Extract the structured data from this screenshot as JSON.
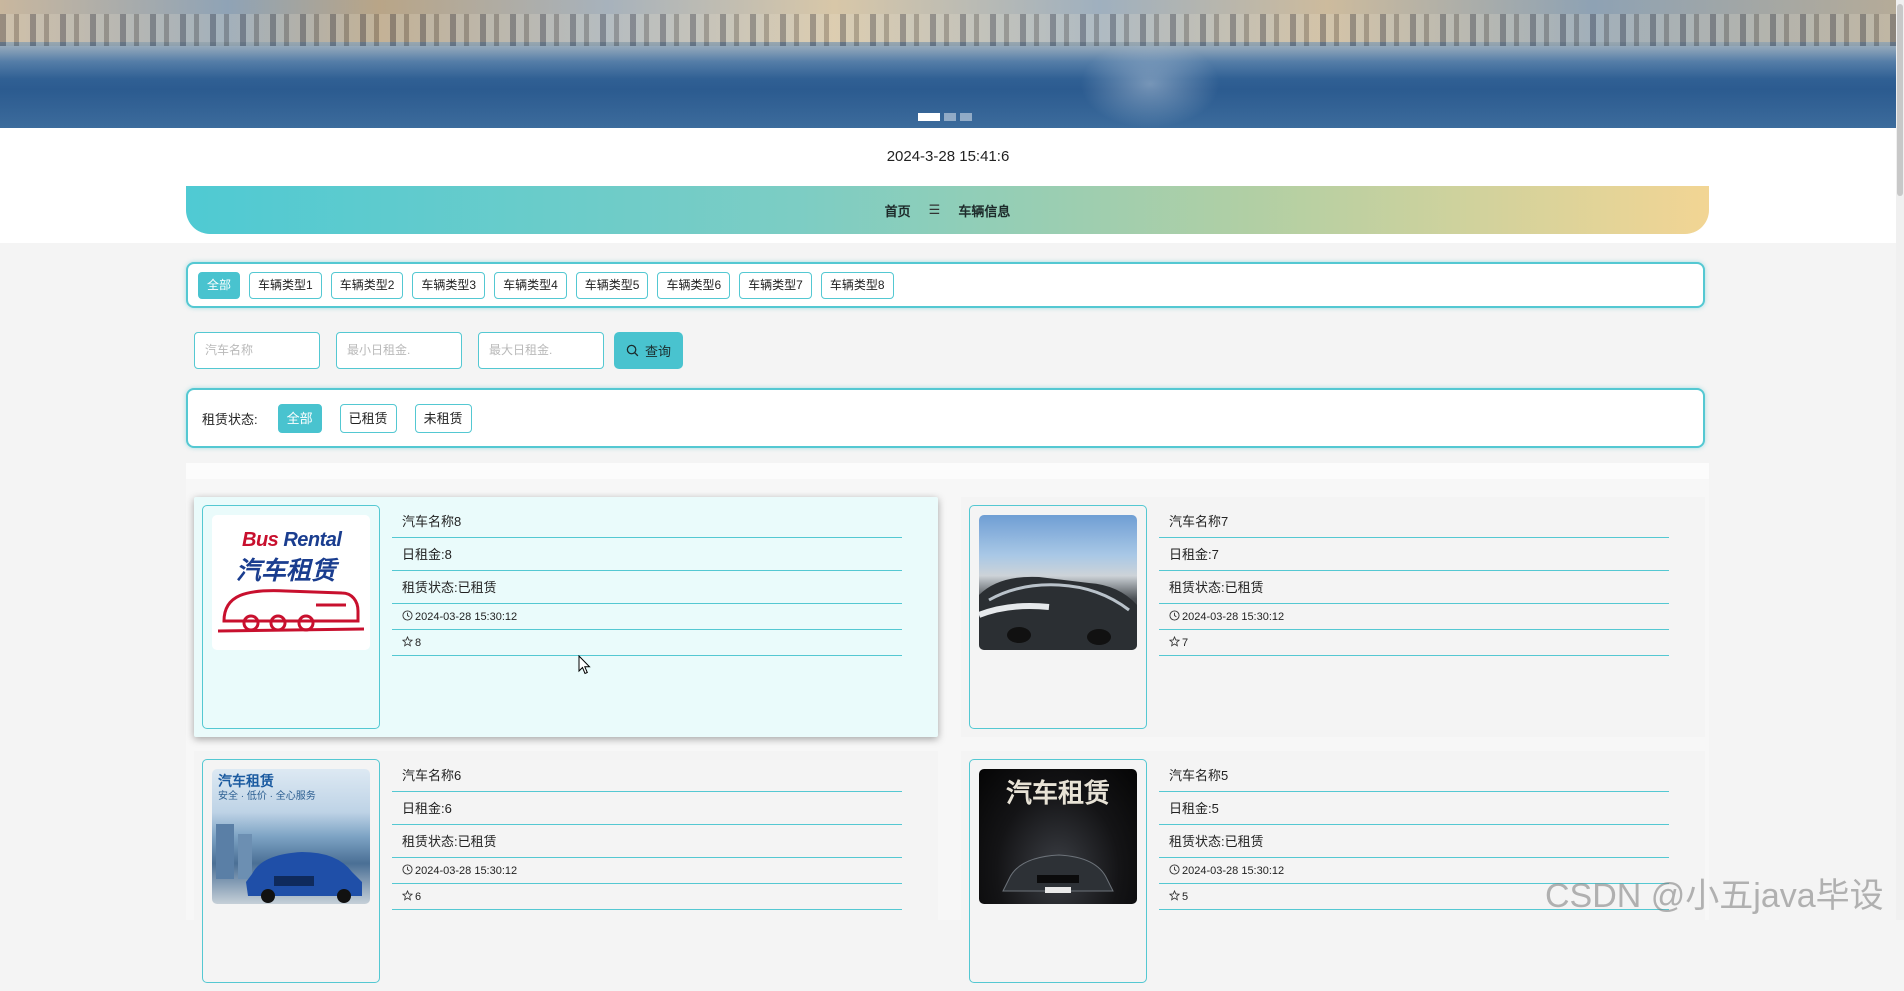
{
  "banner": {
    "slide_count": 3,
    "active_slide": 1
  },
  "datetime": "2024-3-28 15:41:6",
  "nav": {
    "home_label": "首页",
    "menu_icon_glyph": "☰",
    "current_label": "车辆信息"
  },
  "type_filters": [
    "全部",
    "车辆类型1",
    "车辆类型2",
    "车辆类型3",
    "车辆类型4",
    "车辆类型5",
    "车辆类型6",
    "车辆类型7",
    "车辆类型8"
  ],
  "search": {
    "name_placeholder": "汽车名称",
    "min_price_placeholder": "最小日租金.",
    "max_price_placeholder": "最大日租金.",
    "button_label": "查询"
  },
  "status_filter": {
    "label": "租赁状态:",
    "options": [
      "全部",
      "已租赁",
      "未租赁"
    ]
  },
  "cars": [
    {
      "name": "汽车名称8",
      "rent": "日租金:8",
      "status": "租赁状态:已租赁",
      "time": "2024-03-28 15:30:12",
      "stars": "8",
      "image": "bus-rental-logo"
    },
    {
      "name": "汽车名称7",
      "rent": "日租金:7",
      "status": "租赁状态:已租赁",
      "time": "2024-03-28 15:30:12",
      "stars": "7",
      "image": "parking-lot-cars"
    },
    {
      "name": "汽车名称6",
      "rent": "日租金:6",
      "status": "租赁状态:已租赁",
      "time": "2024-03-28 15:30:12",
      "stars": "6",
      "image": "blue-suv-poster"
    },
    {
      "name": "汽车名称5",
      "rent": "日租金:5",
      "status": "租赁状态:已租赁",
      "time": "2024-03-28 15:30:12",
      "stars": "5",
      "image": "dark-rental-poster"
    }
  ],
  "thumb_text": {
    "bus_line1_red": "Bus",
    "bus_line1_blue": " Rental",
    "bus_line2": "汽车租赁",
    "blue_line1": "汽车租赁",
    "blue_line2": "安全 · 低价 · 全心服务",
    "dark_line1": "汽车租赁"
  },
  "watermark": "CSDN @小五java毕设",
  "colors": {
    "accent": "#49c3cf",
    "border": "#54c8d2",
    "nav_start": "#4fcad3",
    "nav_end": "#f2d594"
  }
}
